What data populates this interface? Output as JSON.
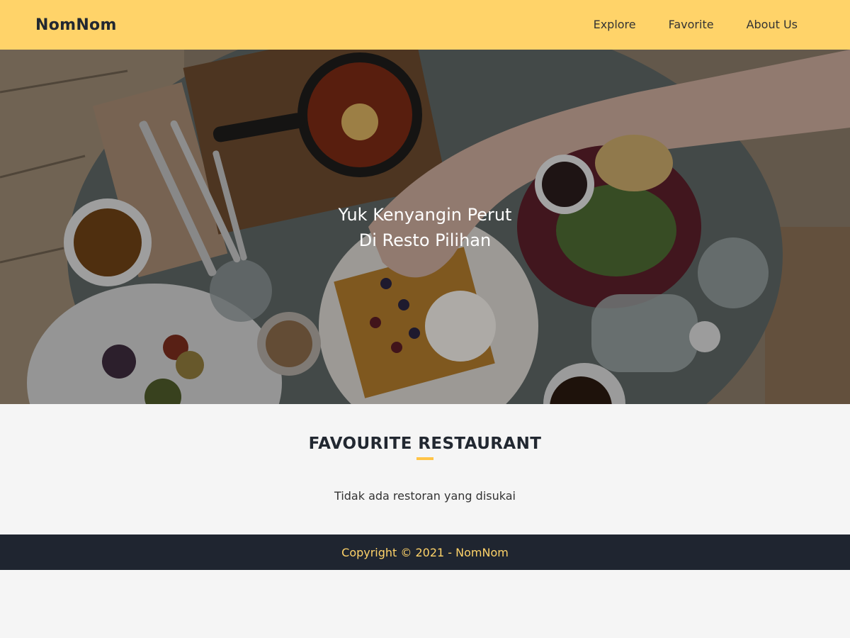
{
  "header": {
    "brand": "NomNom",
    "nav": [
      "Explore",
      "Favorite",
      "About Us"
    ]
  },
  "hero": {
    "line1": "Yuk Kenyangin Perut",
    "line2": "Di Resto Pilihan"
  },
  "main": {
    "title": "FAVOURITE RESTAURANT",
    "empty_message": "Tidak ada restoran yang disukai"
  },
  "footer": {
    "copyright": "Copyright © 2021 - NomNom"
  },
  "colors": {
    "accent": "#ffd369",
    "dark": "#1f2530",
    "background": "#f5f5f5"
  }
}
